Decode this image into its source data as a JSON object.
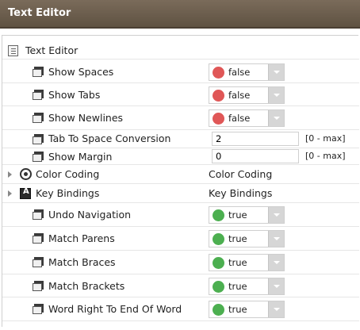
{
  "window": {
    "title": "Text Editor"
  },
  "tree": {
    "root_label": "Text Editor",
    "rows": [
      {
        "label": "Show Spaces",
        "kind": "bool",
        "value": "false",
        "dot_color": "#e05757"
      },
      {
        "label": "Show Tabs",
        "kind": "bool",
        "value": "false",
        "dot_color": "#e05757"
      },
      {
        "label": "Show Newlines",
        "kind": "bool",
        "value": "false",
        "dot_color": "#e05757"
      },
      {
        "label": "Tab To Space Conversion",
        "kind": "number",
        "value": "2",
        "range": "[0 - max]"
      },
      {
        "label": "Show Margin",
        "kind": "number",
        "value": "0",
        "range": "[0 - max]"
      },
      {
        "label": "Color Coding",
        "kind": "folder",
        "value": "Color Coding",
        "icon": "palette-icon"
      },
      {
        "label": "Key Bindings",
        "kind": "folder",
        "value": "Key Bindings",
        "icon": "keyboard-icon"
      },
      {
        "label": "Undo Navigation",
        "kind": "bool",
        "value": "true",
        "dot_color": "#4caf50"
      },
      {
        "label": "Match Parens",
        "kind": "bool",
        "value": "true",
        "dot_color": "#4caf50"
      },
      {
        "label": "Match Braces",
        "kind": "bool",
        "value": "true",
        "dot_color": "#4caf50"
      },
      {
        "label": "Match Brackets",
        "kind": "bool",
        "value": "true",
        "dot_color": "#4caf50"
      },
      {
        "label": "Word Right To End Of Word",
        "kind": "bool",
        "value": "true",
        "dot_color": "#4caf50"
      }
    ]
  },
  "colors": {
    "title_bar": "#6d5f4f",
    "false_dot": "#e05757",
    "true_dot": "#4caf50"
  }
}
